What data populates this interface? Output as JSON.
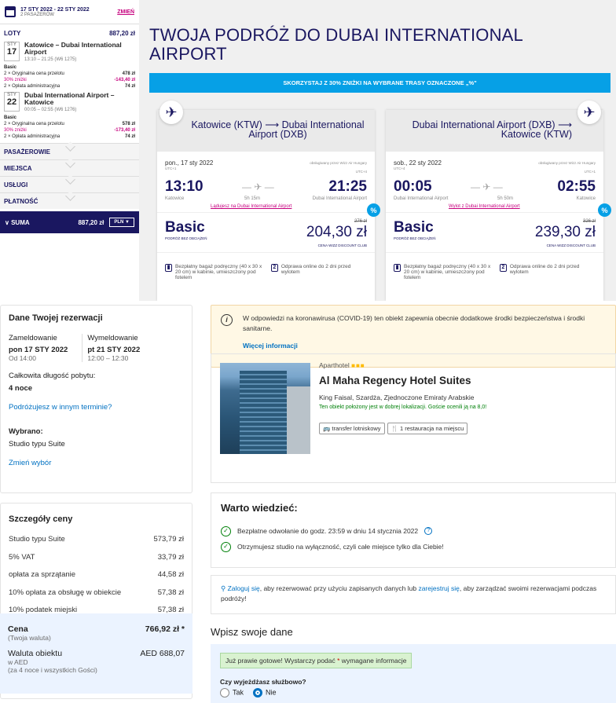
{
  "trip": {
    "dates": "17 STY 2022 - 22 STY 2022",
    "pax": "2 PASAŻERÓW",
    "change": "ZMIEŃ",
    "flights_label": "LOTY",
    "flights_total": "887,20 zł"
  },
  "leg1": {
    "month": "STY",
    "day": "17",
    "route": "Katowice – Dubai International Airport",
    "times": "13:10 – 21:25 (W6 1275)",
    "fare_title": "Basic",
    "fare_lines": [
      {
        "l": "2 × Oryginalna cena przelotu",
        "v": "478 zł"
      },
      {
        "l": "30% zniżki",
        "v": "-143,40 zł"
      },
      {
        "l": "2 × Opłata administracyjna",
        "v": "74 zł"
      }
    ]
  },
  "leg2": {
    "month": "STY",
    "day": "22",
    "route": "Dubai International Airport – Katowice",
    "times": "00:05 – 02:55 (W6 1276)",
    "fare_title": "Basic",
    "fare_lines": [
      {
        "l": "2 × Oryginalna cena przelotu",
        "v": "578 zł"
      },
      {
        "l": "30% zniżki",
        "v": "-173,40 zł"
      },
      {
        "l": "2 × Opłata administracyjna",
        "v": "74 zł"
      }
    ]
  },
  "nav": [
    "PASAŻEROWIE",
    "MIEJSCA",
    "USŁUGI",
    "PŁATNOŚĆ"
  ],
  "suma": {
    "label": "SUMA",
    "value": "887,20 zł",
    "currency": "PLN"
  },
  "hero": "TWOJA PODRÓŻ DO DUBAI INTERNATIONAL AIRPORT",
  "banner": "SKORZYSTAJ Z 30% ZNIŻKI NA WYBRANE TRASY OZNACZONE „%\"",
  "cards": [
    {
      "title": "Katowice (KTW) ⟶ Dubai International Airport (DXB)",
      "date": "pon., 17 sty 2022",
      "operator": "obsługiwany przez Wizz Air Hungary",
      "utc1": "UTC+1",
      "utc2": "UTC+4",
      "dep": "13:10",
      "arr": "21:25",
      "dur": "5h 15m",
      "from": "Katowice",
      "to": "Dubai International Airport",
      "link": "Lądujesz na Dubai International Airport",
      "fare": "Basic",
      "fare_sub": "PODRÓŻ BEZ OBCIĄŻEŃ",
      "old": "276 zł",
      "price": "204,30 zł",
      "club": "CENA WIZZ DISCOUNT CLUB",
      "feat1": "Bezpłatny bagaż podręczny (40 x 30 x 20 cm) w kabinie, umieszczony pod fotelem",
      "feat2": "Odprawa online do 2 dni przed wylotem",
      "pct": "%"
    },
    {
      "title": "Dubai International Airport (DXB) ⟶ Katowice (KTW)",
      "date": "sob., 22 sty 2022",
      "operator": "obsługiwany przez Wizz Air Hungary",
      "utc1": "UTC+4",
      "utc2": "UTC+1",
      "dep": "00:05",
      "arr": "02:55",
      "dur": "5h 50m",
      "from": "Dubai International Airport",
      "to": "Katowice",
      "link": "Wylot z Dubai International Airport",
      "fare": "Basic",
      "fare_sub": "PODRÓŻ BEZ OBCIĄŻEŃ",
      "old": "326 zł",
      "price": "239,30 zł",
      "club": "CENA WIZZ DISCOUNT CLUB",
      "feat1": "Bezpłatny bagaż podręczny (40 x 30 x 20 cm) w kabinie, umieszczony pod fotelem",
      "feat2": "Odprawa online do 2 dni przed wylotem",
      "pct": "%"
    }
  ],
  "res": {
    "title": "Dane Twojej rezerwacji",
    "checkin_l": "Zameldowanie",
    "checkin": "pon 17 STY 2022",
    "checkin_t": "Od 14:00",
    "checkout_l": "Wymeldowanie",
    "checkout": "pt 21 STY 2022",
    "checkout_t": "12:00 – 12:30",
    "stay_l": "Całkowita długość pobytu:",
    "stay": "4 noce",
    "other": "Podróżujesz w innym terminie?",
    "chosen_l": "Wybrano:",
    "chosen": "Studio typu Suite",
    "change": "Zmień wybór"
  },
  "price": {
    "title": "Szczegóły ceny",
    "rows": [
      {
        "l": "Studio typu Suite",
        "v": "573,79 zł"
      },
      {
        "l": "5% VAT",
        "v": "33,79 zł"
      },
      {
        "l": "opłata za sprzątanie",
        "v": "44,58 zł"
      },
      {
        "l": "10% opłata za obsługę w obiekcie",
        "v": "57,38 zł"
      },
      {
        "l": "10% podatek miejski",
        "v": "57,38 zł"
      }
    ],
    "total_l": "Cena",
    "total": "766,92 zł *",
    "total_sub": "(Twoja waluta)",
    "cur_l": "Waluta obiektu",
    "cur": "AED 688,07",
    "cur_sub1": "w AED",
    "cur_sub2": "(za 4 noce i wszystkich Gości)"
  },
  "covid": {
    "text": "W odpowiedzi na koronawirusa (COVID-19) ten obiekt zapewnia obecnie dodatkowe środki bezpieczeństwa i środki sanitarne.",
    "more": "Więcej informacji"
  },
  "hotel": {
    "type": "Aparthotel",
    "stars": "■■■",
    "name": "Al Maha Regency Hotel Suites",
    "addr": "King Faisal, Szardża, Zjednoczone Emiraty Arabskie",
    "loc": "Ten obiekt położony jest w dobrej lokalizacji. Goście ocenili ją na 8,0!",
    "tag1": "🚌 transfer lotniskowy",
    "tag2": "🍴 1 restauracja na miejscu"
  },
  "know": {
    "title": "Warto wiedzieć:",
    "i1": "Bezpłatne odwołanie do godz. 23:59 w dniu 14 stycznia 2022",
    "i2": "Otrzymujesz studio na wyłączność, czyli całe miejsce tylko dla Ciebie!"
  },
  "login": {
    "a": "Zaloguj się",
    "t1": ", aby rezerwować przy użyciu zapisanych danych lub ",
    "b": "zarejestruj się",
    "t2": ", aby zarządzać swoimi rezerwacjami podczas podróży!"
  },
  "form": {
    "title": "Wpisz swoje dane",
    "ready1": "Już prawie gotowe! Wystarczy podać ",
    "star": "*",
    "ready2": " wymagane informacje",
    "q": "Czy wyjeżdżasz służbowo?",
    "yes": "Tak",
    "no": "Nie"
  }
}
